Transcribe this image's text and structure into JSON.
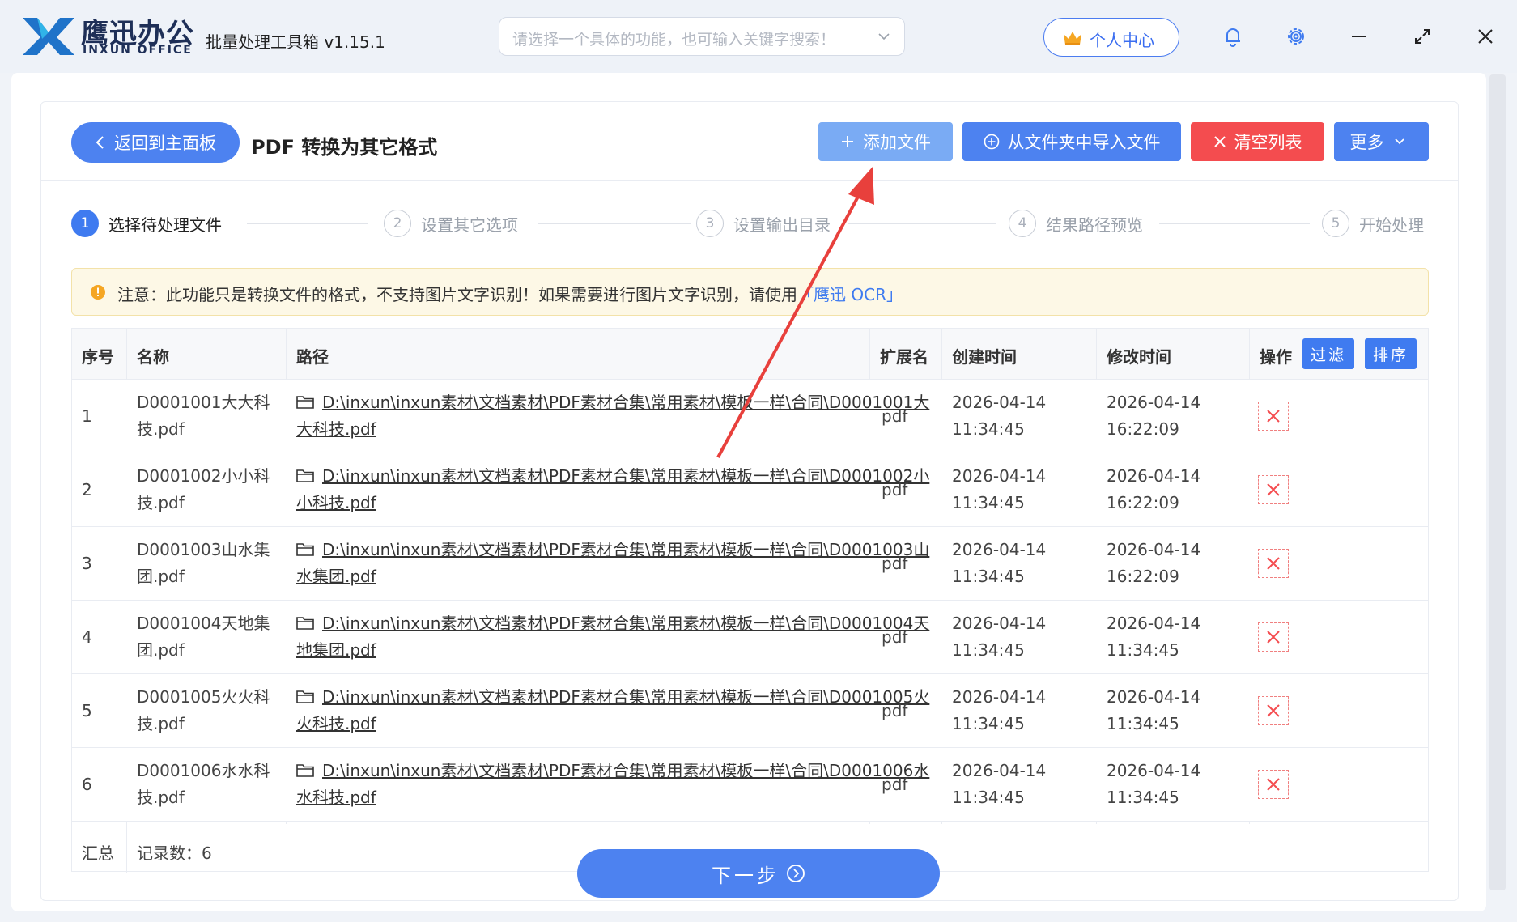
{
  "titlebar": {
    "brand_cn": "鹰迅办公",
    "brand_en": "INXUN OFFICE",
    "app_title": "批量处理工具箱 v1.15.1",
    "search_placeholder": "请选择一个具体的功能，也可输入关键字搜索！",
    "user_center": "个人中心"
  },
  "header": {
    "back_label": "返回到主面板",
    "page_title": "PDF 转换为其它格式",
    "add_file": "添加文件",
    "import_folder": "从文件夹中导入文件",
    "clear_list": "清空列表",
    "more": "更多"
  },
  "steps": [
    {
      "num": "1",
      "label": "选择待处理文件",
      "active": true
    },
    {
      "num": "2",
      "label": "设置其它选项",
      "active": false
    },
    {
      "num": "3",
      "label": "设置输出目录",
      "active": false
    },
    {
      "num": "4",
      "label": "结果路径预览",
      "active": false
    },
    {
      "num": "5",
      "label": "开始处理",
      "active": false
    }
  ],
  "notice": {
    "text": "注意：此功能只是转换文件的格式，不支持图片文字识别！如果需要进行图片文字识别，请使用",
    "link": "「鹰迅 OCR」"
  },
  "table": {
    "headers": {
      "index": "序号",
      "name": "名称",
      "path": "路径",
      "ext": "扩展名",
      "ctime": "创建时间",
      "mtime": "修改时间",
      "action": "操作"
    },
    "filter_label": "过滤",
    "sort_label": "排序",
    "rows": [
      {
        "index": "1",
        "name": "D0001001大大科技.pdf",
        "path": "D:\\inxun\\inxun素材\\文档素材\\PDF素材合集\\常用素材\\模板一样\\合同\\D0001001大大科技.pdf",
        "ext": "pdf",
        "ctime": "2026-04-14 11:34:45",
        "mtime": "2026-04-14 16:22:09"
      },
      {
        "index": "2",
        "name": "D0001002小小科技.pdf",
        "path": "D:\\inxun\\inxun素材\\文档素材\\PDF素材合集\\常用素材\\模板一样\\合同\\D0001002小小科技.pdf",
        "ext": "pdf",
        "ctime": "2026-04-14 11:34:45",
        "mtime": "2026-04-14 16:22:09"
      },
      {
        "index": "3",
        "name": "D0001003山水集团.pdf",
        "path": "D:\\inxun\\inxun素材\\文档素材\\PDF素材合集\\常用素材\\模板一样\\合同\\D0001003山水集团.pdf",
        "ext": "pdf",
        "ctime": "2026-04-14 11:34:45",
        "mtime": "2026-04-14 16:22:09"
      },
      {
        "index": "4",
        "name": "D0001004天地集团.pdf",
        "path": "D:\\inxun\\inxun素材\\文档素材\\PDF素材合集\\常用素材\\模板一样\\合同\\D0001004天地集团.pdf",
        "ext": "pdf",
        "ctime": "2026-04-14 11:34:45",
        "mtime": "2026-04-14 11:34:45"
      },
      {
        "index": "5",
        "name": "D0001005火火科技.pdf",
        "path": "D:\\inxun\\inxun素材\\文档素材\\PDF素材合集\\常用素材\\模板一样\\合同\\D0001005火火科技.pdf",
        "ext": "pdf",
        "ctime": "2026-04-14 11:34:45",
        "mtime": "2026-04-14 11:34:45"
      },
      {
        "index": "6",
        "name": "D0001006水水科技.pdf",
        "path": "D:\\inxun\\inxun素材\\文档素材\\PDF素材合集\\常用素材\\模板一样\\合同\\D0001006水水科技.pdf",
        "ext": "pdf",
        "ctime": "2026-04-14 11:34:45",
        "mtime": "2026-04-14 11:34:45"
      }
    ],
    "footer": {
      "label": "汇总",
      "count": "记录数：6"
    }
  },
  "next_label": "下一步",
  "colors": {
    "primary": "#4d82f0",
    "danger": "#f44c4f",
    "annotation_arrow": "#e8403c"
  }
}
